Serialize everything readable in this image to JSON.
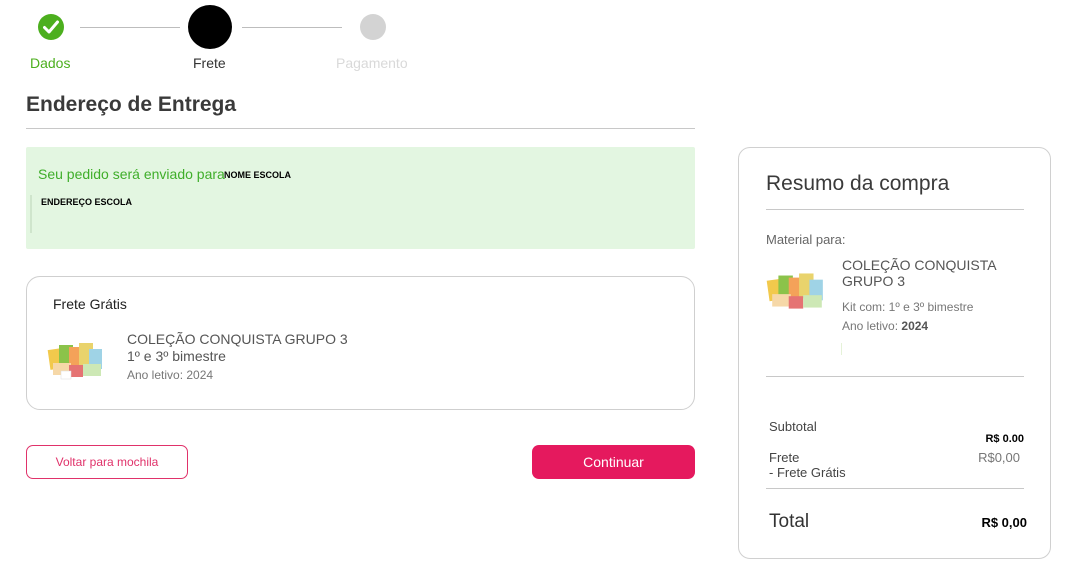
{
  "stepper": {
    "steps": [
      {
        "label": "Dados",
        "state": "done"
      },
      {
        "label": "Frete",
        "state": "current"
      },
      {
        "label": "Pagamento",
        "state": "upcoming"
      }
    ],
    "colors": {
      "done": "#4caf1e",
      "current": "#000000",
      "upcoming": "#d3d3d3"
    }
  },
  "page": {
    "title": "Endereço de Entrega"
  },
  "delivery_notice": {
    "prefix": "Seu pedido será enviado para",
    "school_name": "NOME ESCOLA",
    "school_address": "ENDEREÇO ESCOLA",
    "background": "#e3f6e1",
    "text_color": "#3fae2a"
  },
  "shipping": {
    "title": "Frete Grátis",
    "product_name": "COLEÇÃO CONQUISTA GRUPO 3",
    "bimesters": "1º e 3º bimestre",
    "school_year": "Ano letivo: 2024",
    "image_icon": "product-kit-image"
  },
  "actions": {
    "back_label": "Voltar para mochila",
    "continue_label": "Continuar",
    "accent": "#e5195e"
  },
  "summary": {
    "title": "Resumo da compra",
    "material_label": "Material para:",
    "product_name": "COLEÇÃO CONQUISTA GRUPO 3",
    "kit_label": "Kit com: 1º e 3º bimestre",
    "year_label": "Ano letivo:",
    "year_value": "2024",
    "subtotal_label": "Subtotal",
    "subtotal_value": "R$ 0.00",
    "frete_label": "Frete",
    "frete_sub_label": "- Frete Grátis",
    "frete_value": "R$0,00",
    "total_label": "Total",
    "total_value": "R$ 0,00"
  }
}
